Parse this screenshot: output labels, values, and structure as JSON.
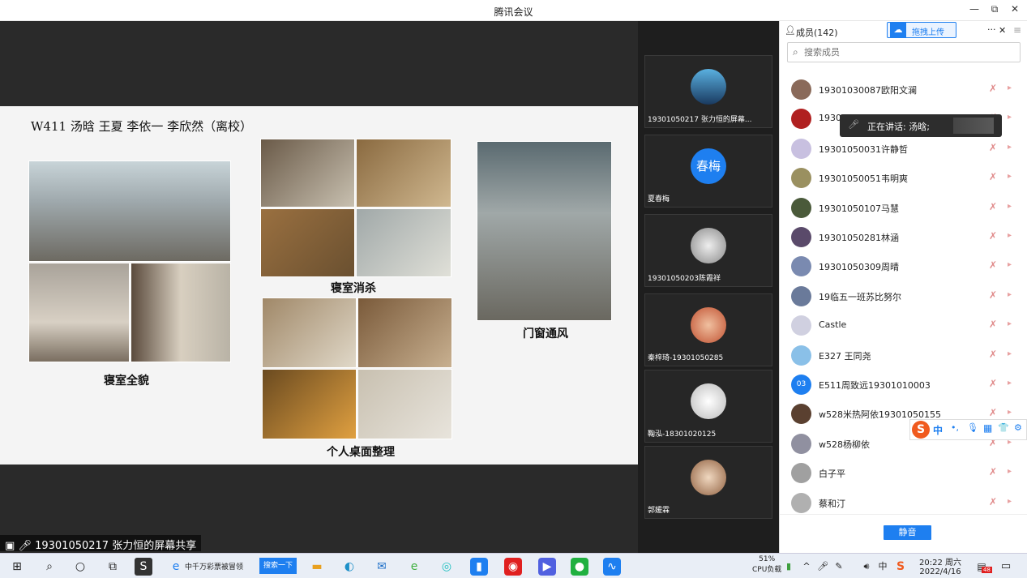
{
  "window": {
    "title": "腾讯会议",
    "minimize": "—",
    "restore": "⧉",
    "close": "✕"
  },
  "slide": {
    "heading": "W411 汤晗 王夏 李依一 李欣然（离校）",
    "captions": {
      "overview": "寝室全貌",
      "disinfect": "寝室消杀",
      "ventilate": "门窗通风",
      "desk": "个人桌面整理"
    }
  },
  "share_label": "19301050217 张力恒的屏幕共享",
  "thumbnails": [
    {
      "name": "19301050217 张力恒的屏幕...",
      "avatar_color": "#4a9fd0"
    },
    {
      "name": "夏春梅",
      "avatar_text": "春梅",
      "avatar_color": "#1e7ff0"
    },
    {
      "name": "19301050203陈霞祥",
      "avatar_color": "#cfcfcf"
    },
    {
      "name": "秦梓琦-19301050285",
      "avatar_color": "#d97a4a"
    },
    {
      "name": "鞠泓-18301020125",
      "avatar_color": "#e8e8e8"
    },
    {
      "name": "郭媛霖",
      "avatar_color": "#c8a27a"
    }
  ],
  "panel": {
    "members_label": "成员(142)",
    "upload_label": "拖拽上传",
    "more": "···",
    "close": "✕",
    "menu": "≡",
    "search_placeholder": "搜索成员",
    "mute_all": "静音",
    "speaking": "正在讲话: 汤晗;",
    "members": [
      {
        "name": "19301030087欧阳文澜",
        "color": "#8a6a5a"
      },
      {
        "name": "1930",
        "color": "#b02020"
      },
      {
        "name": "19301050031许静哲",
        "color": "#c8c0e0"
      },
      {
        "name": "19301050051韦明爽",
        "color": "#9a9060"
      },
      {
        "name": "19301050107马慧",
        "color": "#4a5a3a"
      },
      {
        "name": "19301050281林涵",
        "color": "#5a4a6a"
      },
      {
        "name": "19301050309周晴",
        "color": "#7a8ab0"
      },
      {
        "name": "19临五一班苏比努尔",
        "color": "#6a7a9a"
      },
      {
        "name": "Castle",
        "color": "#d0d0e0"
      },
      {
        "name": "E327 王同尧",
        "color": "#8ac0e8"
      },
      {
        "name": "E511周致远19301010003",
        "color": "#1e7ff0",
        "badge": "03"
      },
      {
        "name": "w528米热阿依19301050155",
        "color": "#5a4030"
      },
      {
        "name": "w528杨柳依",
        "color": "#9090a0"
      },
      {
        "name": "白子平",
        "color": "#a0a0a0"
      },
      {
        "name": "蔡和汀",
        "color": "#b0b0b0"
      }
    ]
  },
  "ime": {
    "items": [
      "中",
      "•,",
      "🎙",
      "▦",
      "👕",
      "⚙"
    ]
  },
  "taskbar": {
    "start": "⊞",
    "search": "⌕",
    "cortana": "○",
    "taskview": "⧉",
    "ie_text": "中千万彩票被冒领",
    "search_btn": "搜索一下",
    "cpu_pct": "51%",
    "cpu_label": "CPU负载",
    "time": "20:22 周六",
    "date": "2022/4/16",
    "lang": "中",
    "notif_count": "48"
  }
}
